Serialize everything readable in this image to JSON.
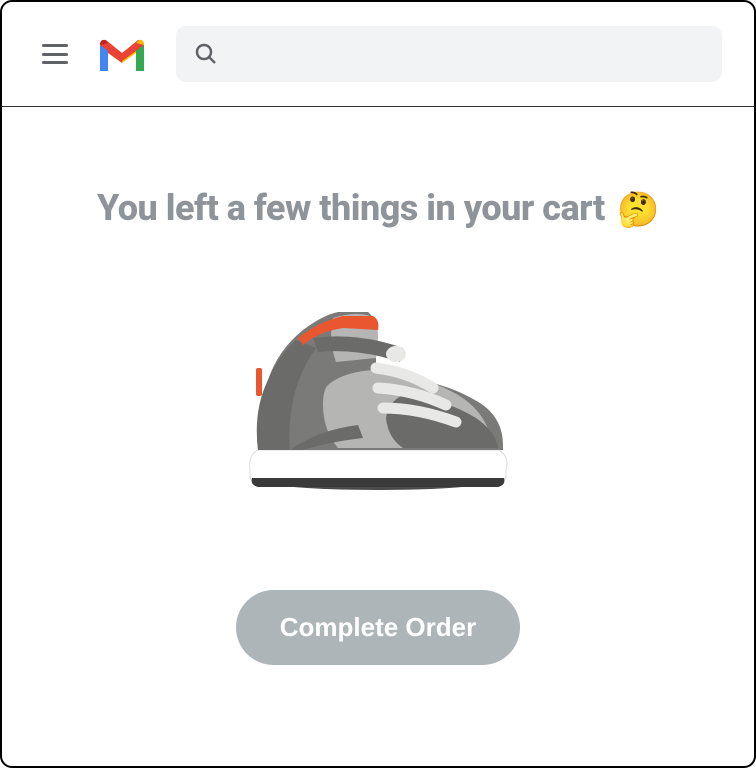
{
  "header": {
    "menu_label": "Menu",
    "logo_label": "Gmail",
    "search_placeholder": ""
  },
  "email": {
    "headline_text": "You left a few things in your cart",
    "headline_emoji": "🤔",
    "product_name": "Gray high-top sneaker",
    "cta_label": "Complete Order"
  }
}
